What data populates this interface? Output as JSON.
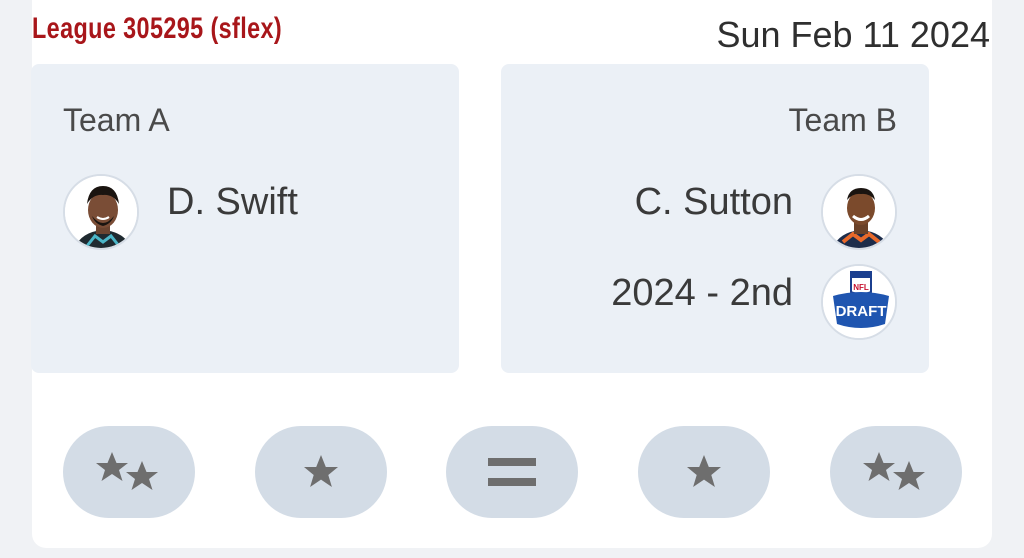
{
  "header": {
    "league_title": "League 305295 (sflex)",
    "date": "Sun Feb 11 2024"
  },
  "team_a": {
    "label": "Team A",
    "assets": [
      {
        "name": "D. Swift",
        "icon": "player-headshot"
      }
    ]
  },
  "team_b": {
    "label": "Team B",
    "assets": [
      {
        "name": "C. Sutton",
        "icon": "player-headshot"
      },
      {
        "name": "2024 - 2nd",
        "icon": "nfl-draft-logo"
      }
    ]
  },
  "vote_buttons": [
    {
      "icon": "double-star-icon"
    },
    {
      "icon": "star-icon"
    },
    {
      "icon": "equal-icon"
    },
    {
      "icon": "star-icon"
    },
    {
      "icon": "double-star-icon"
    }
  ],
  "colors": {
    "league_title": "#a8161a",
    "team_box_bg": "#ebf0f6",
    "vote_button_bg": "#d3dce6",
    "icon_gray": "#6e6e6e"
  }
}
